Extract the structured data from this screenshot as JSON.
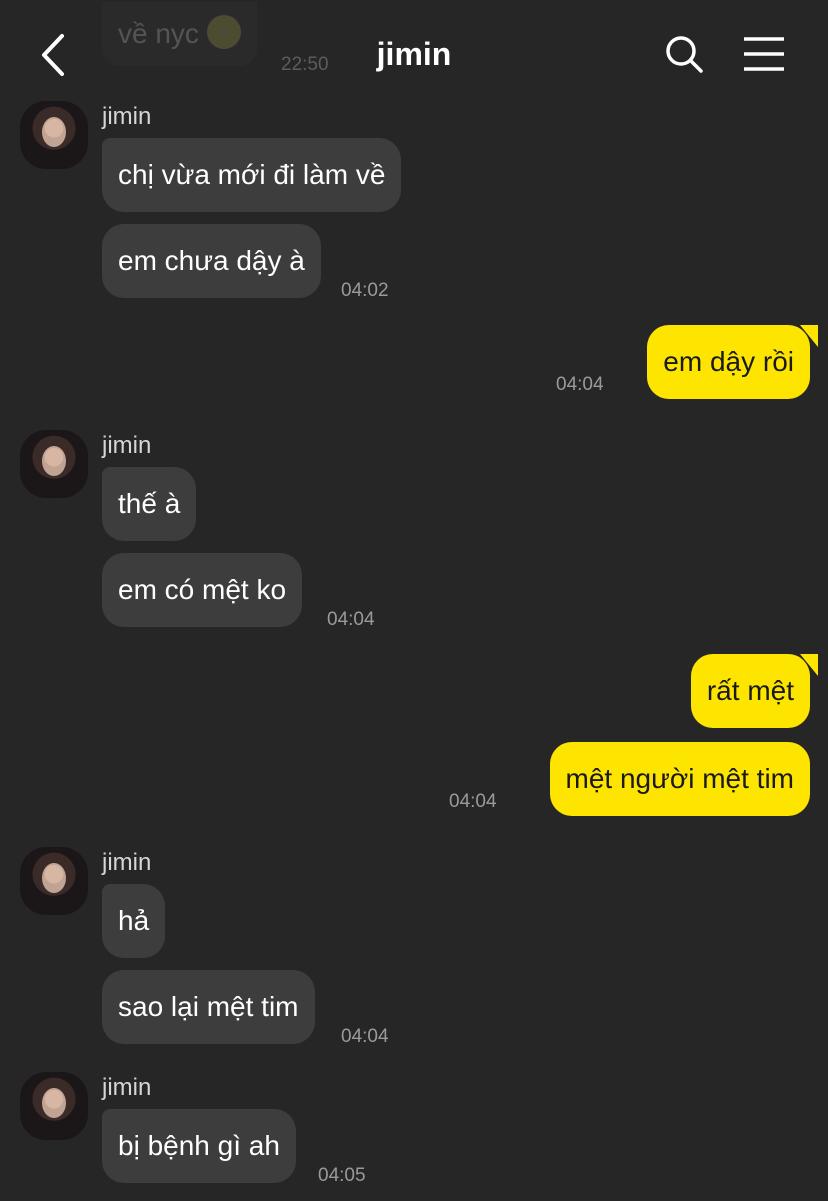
{
  "header": {
    "title": "jimin",
    "back_icon": "chevron-left-icon",
    "search_icon": "search-icon",
    "menu_icon": "hamburger-menu-icon"
  },
  "previous": {
    "text": "về nyc",
    "time": "22:50"
  },
  "colors": {
    "background": "#262626",
    "incoming_bubble": "#3d3d3d",
    "outgoing_bubble": "#fee500"
  },
  "messages": {
    "g1": {
      "sender": "jimin",
      "m1": "chị vừa mới đi làm về",
      "m2": "em chưa dậy à",
      "time": "04:02"
    },
    "g2": {
      "m1": "em dậy rồi",
      "time": "04:04"
    },
    "g3": {
      "sender": "jimin",
      "m1": "thế à",
      "m2": "em có mệt ko",
      "time": "04:04"
    },
    "g4": {
      "m1": "rất mệt",
      "m2": "mệt người mệt tim",
      "time": "04:04"
    },
    "g5": {
      "sender": "jimin",
      "m1": "hả",
      "m2": "sao lại mệt tim",
      "time": "04:04"
    },
    "g6": {
      "sender": "jimin",
      "m1": "bị bệnh gì ah",
      "time": "04:05"
    }
  }
}
